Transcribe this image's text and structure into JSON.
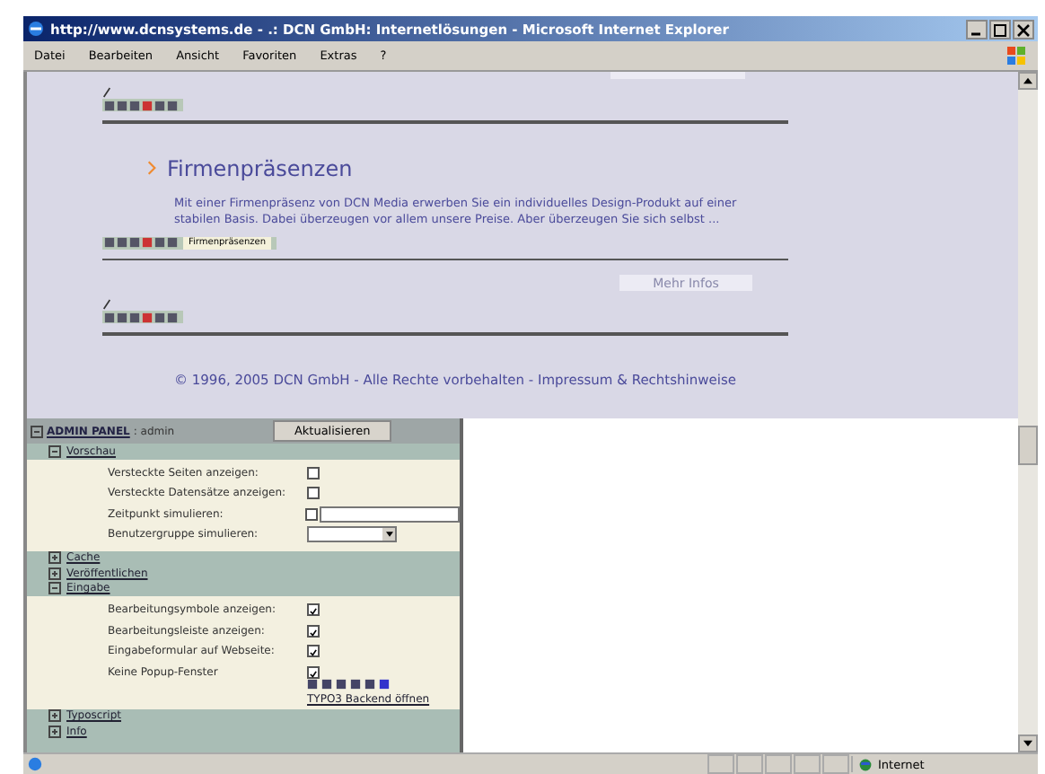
{
  "window": {
    "title": "http://www.dcnsystems.de - .: DCN GmbH: Internetlösungen - Microsoft Internet Explorer"
  },
  "menu": [
    "Datei",
    "Bearbeiten",
    "Ansicht",
    "Favoriten",
    "Extras",
    "?"
  ],
  "page": {
    "blocks": [
      {
        "kind": "toolbar",
        "pencil": true
      },
      {
        "kind": "heading",
        "text": "Firmenpräsenzen"
      },
      {
        "kind": "paragraph",
        "text": "Mit einer Firmenpräsenz von DCN Media erwerben Sie ein individuelles Design-Produkt auf einer stabilen Basis. Dabei überzeugen vor allem unsere Preise. Aber überzeugen Sie sich selbst ..."
      },
      {
        "kind": "toolbar",
        "pencil": false,
        "label": "Firmenpräsenzen"
      },
      {
        "kind": "button",
        "text": "Mehr Infos"
      },
      {
        "kind": "toolbar",
        "pencil": true
      }
    ],
    "footer": "© 1996, 2005 DCN GmbH - Alle Rechte vorbehalten - Impressum & Rechtshinweise"
  },
  "admin": {
    "title": "ADMIN PANEL",
    "user": ": admin",
    "button": "Aktualisieren",
    "sections": [
      {
        "label": "Vorschau",
        "expanded": true,
        "rows": [
          {
            "kind": "checkbox",
            "label": "Versteckte Seiten anzeigen:",
            "checked": false
          },
          {
            "kind": "checkbox",
            "label": "Versteckte Datensätze anzeigen:",
            "checked": false
          },
          {
            "kind": "checkbox_input",
            "label": "Zeitpunkt simulieren:",
            "checked": false
          },
          {
            "kind": "select",
            "label": "Benutzergruppe simulieren:"
          }
        ]
      },
      {
        "label": "Cache",
        "expanded": false
      },
      {
        "label": "Veröffentlichen",
        "expanded": false
      },
      {
        "label": "Eingabe",
        "expanded": true,
        "rows": [
          {
            "kind": "checkbox",
            "label": "Bearbeitungsymbole anzeigen:",
            "checked": true
          },
          {
            "kind": "checkbox",
            "label": "Bearbeitungsleiste anzeigen:",
            "checked": true
          },
          {
            "kind": "checkbox",
            "label": "Eingabeformular auf Webseite:",
            "checked": true
          },
          {
            "kind": "checkbox",
            "label": "Keine Popup-Fenster",
            "checked": true
          },
          {
            "kind": "icons",
            "link": "TYPO3 Backend öffnen"
          }
        ]
      },
      {
        "label": "Typoscript",
        "expanded": false
      },
      {
        "label": "Info",
        "expanded": false
      }
    ]
  },
  "status_bar": {
    "zone": "Internet"
  }
}
